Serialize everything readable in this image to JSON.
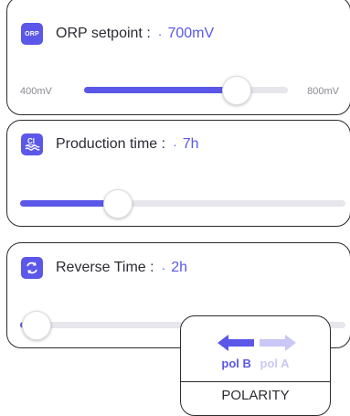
{
  "orp": {
    "icon": "orp-icon",
    "icon_text": "ORP",
    "title": "ORP setpoint :",
    "separator": "·",
    "value": "700mV",
    "min_label": "400mV",
    "max_label": "800mV",
    "slider_level": 0.75
  },
  "production": {
    "icon": "cl-icon",
    "icon_text": "Cl",
    "title": "Production time :",
    "separator": "·",
    "value": "7h",
    "slider_level": 0.3
  },
  "reverse": {
    "icon": "reverse-icon",
    "title": "Reverse Time :",
    "separator": "·",
    "value": "2h",
    "slider_level": 0.05
  },
  "polarity": {
    "label_b": "pol B",
    "label_a": "pol A",
    "title": "POLARITY"
  },
  "colors": {
    "accent": "#5b57e8",
    "accent_light": "#c9c7f5",
    "track": "#e6e6ec",
    "border": "#2a2a30"
  }
}
